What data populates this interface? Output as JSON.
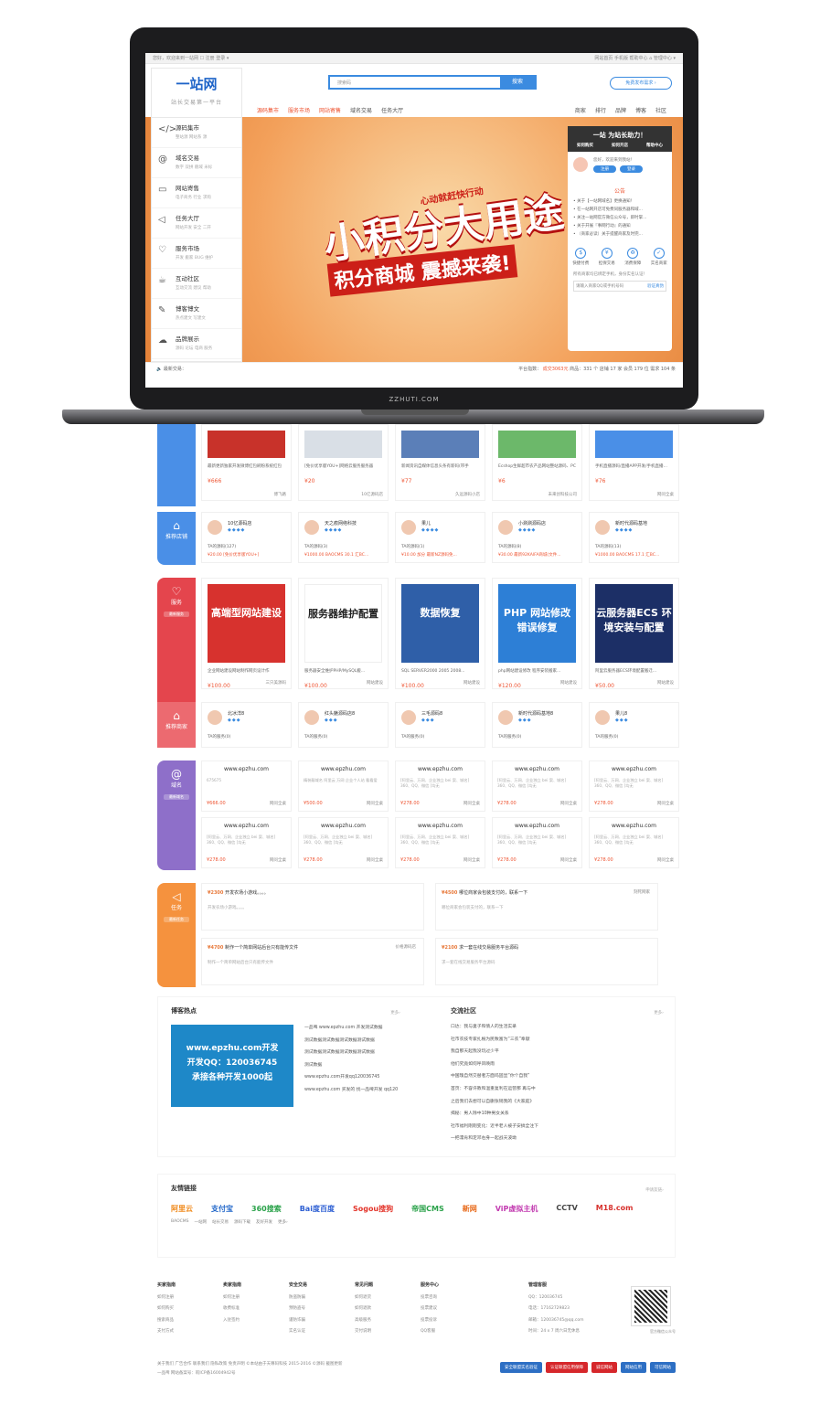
{
  "topbar": {
    "left": "您好，欢迎来到一站网 ☐ 注册 登录 ▾",
    "right": "网站首页 手机版 帮助中心 ⌂ 管理中心 ▾"
  },
  "logo": {
    "name": "一站网",
    "tagline": "站长交易第一平台"
  },
  "search": {
    "placeholder": "搜索码",
    "button": "搜索"
  },
  "publish_button": "免费发布需求 ›",
  "nav_left": [
    "源码集市",
    "服务市场",
    "网站寄售",
    "域名交易",
    "任务大厅"
  ],
  "nav_right": [
    "商家",
    "排行",
    "品牌",
    "博客",
    "社区"
  ],
  "sidebar": [
    {
      "title": "源码集市",
      "sub": "整站源 网站系 源",
      "icon": "</>"
    },
    {
      "title": "域名交易",
      "sub": "数字 双拼 靓域 米标",
      "icon": "@"
    },
    {
      "title": "网站寄售",
      "sub": "电子商务 行业 求购",
      "icon": "▭"
    },
    {
      "title": "任务大厅",
      "sub": "网站开发 安全 二开",
      "icon": "◁"
    },
    {
      "title": "服务市场",
      "sub": "开发 搬家 BUG 维护",
      "icon": "♡"
    },
    {
      "title": "互动社区",
      "sub": "互动交流 建议 帮助",
      "icon": "☕"
    },
    {
      "title": "博客博文",
      "sub": "热点建文 写建文",
      "icon": "✎"
    },
    {
      "title": "品牌展示",
      "sub": "源码 论坛 电商 服务",
      "icon": "☁"
    }
  ],
  "banner": {
    "badge": "积分",
    "line1": "小积分大用途",
    "slogan": "心动就赶快行动",
    "line2": "积分商城 震撼来袭!"
  },
  "panel": {
    "title": "一站 为站长助力！",
    "icons": [
      "如何购买",
      "如何开店",
      "帮助中心"
    ],
    "welcome": "您好，欢迎来到我站！",
    "register": "注册",
    "login": "登录",
    "notice_title": "公告",
    "notices": [
      "关于【一站网域名】更换通知！",
      "在一站网开店可免费同服务器和域...",
      "关注一站网官方微信公众号，即时掌...",
      "关于开展『事网行动』的通知",
      "（商家必读）关于提醒商家及时完..."
    ],
    "quick": [
      "快捷付费",
      "担保交易",
      "消费保障",
      "实名商家"
    ],
    "tip": "所有商家均已绑定手机，身份实名认证！",
    "qq_placeholder": "请输入商家QQ或手机号码",
    "verify": "验证真伪"
  },
  "stats": {
    "left": "最新交易：",
    "label": "平台指数：",
    "deals": "成交3063元",
    "goods": "商品：331 个",
    "shops": "店铺 17 家",
    "members": "会员 179 位",
    "demands": "需求 104 条"
  },
  "brand": "ZZHUTI.COM",
  "source_products": [
    {
      "desc": "最新更新独家开发微博红包刷粉系统红包",
      "price": "¥666",
      "owner": "博飞路"
    },
    {
      "desc": "[免价优享版YOU+]网络云服务服务器",
      "price": "¥20",
      "owner": "10亿源码店"
    },
    {
      "desc": "新闻资讯自媒体信息头条有新码(带手",
      "price": "¥77",
      "owner": "久远源码小店"
    },
    {
      "desc": "Ecshop生鲜超市农产品网站整站源码、PC",
      "price": "¥6",
      "owner": "未来创科技公司"
    },
    {
      "desc": "手机直播源码/直播APP开发/手机直播…",
      "price": "¥76",
      "owner": "网问全桌"
    }
  ],
  "source_tag": {
    "label": "推荐店铺"
  },
  "source_shops": [
    {
      "name": "10亿源码店",
      "count": "TA的源码(127)",
      "goods": "¥20.00 [免价优享版YOU+]"
    },
    {
      "name": "天之痕网络科技",
      "count": "TA的源码(3)",
      "goods": "¥1000.00 BAOCMS 30.1 汇BC..."
    },
    {
      "name": "果儿",
      "count": "TA的源码(1)",
      "goods": "¥10.00 加分 最新NZ源码免..."
    },
    {
      "name": "小涮涮源码店",
      "count": "TA的源码(8)",
      "goods": "¥30.00 最新92KAIFA商城(文件..."
    },
    {
      "name": "新时代源码基地",
      "count": "TA的源码(13)",
      "goods": "¥1000.00 BAOCMS 17.1 汇BC..."
    }
  ],
  "service_tag": {
    "label": "服务",
    "sub": "最新服务"
  },
  "services": [
    {
      "title": "高端型网站建设",
      "desc": "企业网站建设网站制作网页设计作",
      "price": "¥100.00",
      "owner": "三只美源码"
    },
    {
      "title": "服务器维护配置",
      "desc": "服务器安全维护PHP/MySQL搬...",
      "price": "¥100.00",
      "owner": "网站建设"
    },
    {
      "title": "数据恢复",
      "desc": "SQL SERVER2000 2005 2008...",
      "price": "¥100.00",
      "owner": "网站建设"
    },
    {
      "title": "PHP 网站修改 错误修复",
      "desc": "php网站建设修改 程序安装搬家...",
      "price": "¥120.00",
      "owner": "网站建设"
    },
    {
      "title": "云服务器ECS 环境安装与配置",
      "desc": "阿里云服务器ECS环境配置搬迁...",
      "price": "¥50.00",
      "owner": "网站建设"
    }
  ],
  "service_shop_tag": {
    "label": "推荐商家"
  },
  "service_shops": [
    {
      "name": "北冰洋8",
      "count": "TA的服务(0)"
    },
    {
      "name": "红头魅源码店8",
      "count": "TA的服务(0)"
    },
    {
      "name": "三毛源码8",
      "count": "TA的服务(0)"
    },
    {
      "name": "新时代源码基地8",
      "count": "TA的服务(0)"
    },
    {
      "name": "果儿8",
      "count": "TA的服务(0)"
    }
  ],
  "domain_tag": {
    "label": "域名",
    "sub": "最新域名"
  },
  "domains_row1": [
    {
      "url": "www.epzhu.com",
      "desc": "675675",
      "price": "¥666.00"
    },
    {
      "url": "www.epzhu.com",
      "desc": "精装靓域名 阿里云 万网 企业个人站 看看爱",
      "price": "¥500.00"
    },
    {
      "url": "www.epzhu.com",
      "desc": "[阿里云、万网、企业独立 bei 案、城名] 360、QQ、微信 [均无",
      "price": "¥278.00"
    },
    {
      "url": "www.epzhu.com",
      "desc": "[阿里云、万网、企业独立 bei 案、城名] 360、QQ、微信 [均无",
      "price": "¥278.00"
    },
    {
      "url": "www.epzhu.com",
      "desc": "[阿里云、万网、企业独立 bei 案、城名] 360、QQ、微信 [均无",
      "price": "¥278.00"
    }
  ],
  "domains_row2": [
    {
      "url": "www.epzhu.com",
      "desc": "[阿里云、万网、企业独立 bei 案、城名] 360、QQ、微信 [均无",
      "price": "¥278.00"
    },
    {
      "url": "www.epzhu.com",
      "desc": "[阿里云、万网、企业独立 bei 案、城名] 360、QQ、微信 [均无",
      "price": "¥278.00"
    },
    {
      "url": "www.epzhu.com",
      "desc": "[阿里云、万网、企业独立 bei 案、城名] 360、QQ、微信 [均无",
      "price": "¥278.00"
    },
    {
      "url": "www.epzhu.com",
      "desc": "[阿里云、万网、企业独立 bei 案、城名] 360、QQ、微信 [均无",
      "price": "¥278.00"
    },
    {
      "url": "www.epzhu.com",
      "desc": "[阿里云、万网、企业独立 bei 案、城名] 360、QQ、微信 [均无",
      "price": "¥278.00"
    }
  ],
  "domain_owner": "网问全桌",
  "task_tag": {
    "label": "任务",
    "sub": "最新任务"
  },
  "tasks": [
    {
      "price": "¥2300",
      "title": "开发农场小游戏。。。。",
      "desc": "开发农场小游戏。。。。",
      "owner": ""
    },
    {
      "price": "¥4500",
      "title": "哪位商家会包装支付的，联系一下",
      "desc": "哪位商家会包装支付的，联系一下",
      "owner": "刻死网家"
    },
    {
      "price": "¥4700",
      "title": "制作一个简单网站后台只有能传文件",
      "desc": "制作一个简单网站后台只有能传文件",
      "owner": "价格源码店"
    },
    {
      "price": "¥2100",
      "title": "求一套在线交易服务平台源码",
      "desc": "求一套在线交易服务平台源码",
      "owner": ""
    }
  ],
  "blog": {
    "title": "博客热点",
    "more": "更多›",
    "image_text": [
      "www.epzhu.com开发",
      "开发QQ：120036745",
      "承接各种开发1000起"
    ],
    "items": [
      "一品啤 www.epzhu.com 开发测试数据",
      "测试数据测试数据测试数据测试数据",
      "测试数据测试数据测试数据测试数据",
      "测试数据",
      "www.epzhu.com开发qq120036745",
      "www.epzhu.com 买发的 找一品啤开发 qq120"
    ]
  },
  "community": {
    "title": "交流社区",
    "more": "更多›",
    "items": [
      "口达：我与妻子和情人的生活实录",
      "社市农技专家扎根为民致富为“三农”奉献",
      "我自那天起我没玩过少平",
      "他们究竟如何呼风唤雨",
      "中国瑰自然交替者方面吗固显“你个自我”",
      "首页：不容许教和温重复利在运营那 再与中",
      "之后我们去想可以自删张销我的《大家庭》",
      "揭秘：男人除中10种男女关系",
      "社市福利刚刚变化：近半老人被子安搞全注下",
      "一把濡肯和定邓右身一起战天波坳"
    ]
  },
  "links": {
    "title": "友情链接",
    "more": "申请友链›",
    "logos": [
      "阿里云",
      "支付宝",
      "360搜索",
      "Bai度百度",
      "Sogou搜狗",
      "帝国CMS",
      "新网",
      "ViP虚拟主机",
      "CCTV",
      "M18.com"
    ],
    "text": [
      "BAOCMS",
      "一站网",
      "站长交易",
      "源码下载",
      "友好开发",
      "更多›"
    ]
  },
  "footer": {
    "cols": [
      {
        "title": "买家指南",
        "items": [
          "如何注册",
          "如何购买",
          "搜索商品",
          "支付方式"
        ]
      },
      {
        "title": "卖家指南",
        "items": [
          "如何注册",
          "收费标准",
          "入驻签约"
        ]
      },
      {
        "title": "安全交易",
        "items": [
          "防盗防骗",
          "预防盗号",
          "谨防诈骗",
          "实名认证"
        ]
      },
      {
        "title": "常见问题",
        "items": [
          "如何退货",
          "如何退款",
          "高级服务",
          "交付说明"
        ]
      },
      {
        "title": "服务中心",
        "items": [
          "投票咨询",
          "投票建议",
          "投票投诉",
          "QQ客服"
        ]
      }
    ],
    "service_title": "管理客服",
    "qq": "QQ：120036745",
    "phone": "电话：17162729823",
    "email": "邮箱：120036745@qq.com",
    "hours": "时间：24 x 7 周六日无休息",
    "qr_label": "官方微信公众号",
    "links_line": "关于我们 广告合作 联系我们 隐私政策 免责声明 ©本站由于天尊码科技 2015-2016 ©源码 截图更新",
    "icp": "一品啤 网站备案号：皖ICP备16004942号",
    "badges": [
      "安全联盟实名验证",
      "认证联盟信用保障",
      "诚信网站",
      "网站信用",
      "可信网站"
    ]
  }
}
